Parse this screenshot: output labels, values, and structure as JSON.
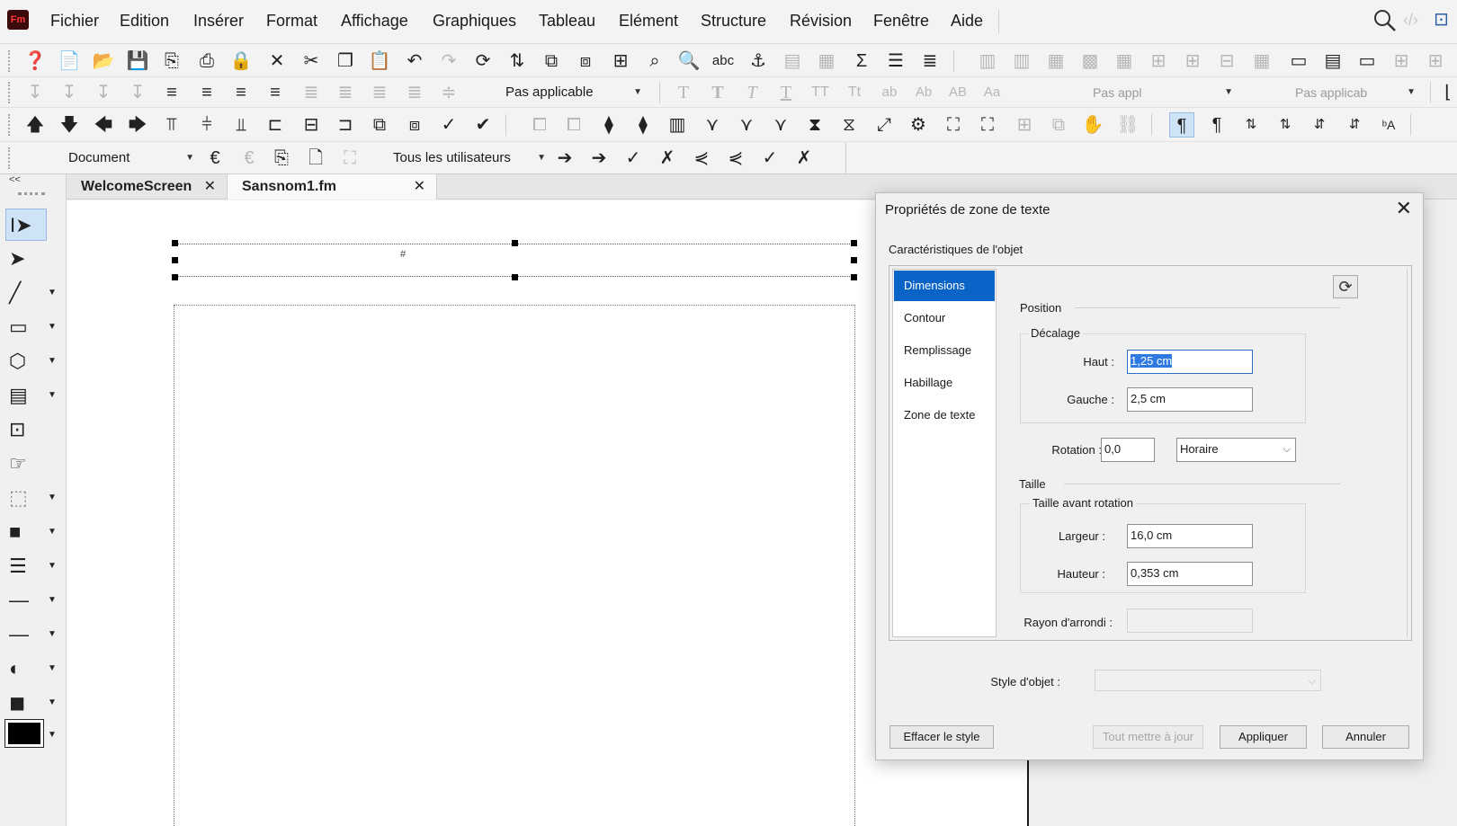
{
  "app": {
    "logo": "Fm"
  },
  "menu": [
    "Fichier",
    "Edition",
    "Insérer",
    "Format",
    "Affichage",
    "Graphiques",
    "Tableau",
    "Elément",
    "Structure",
    "Révision",
    "Fenêtre",
    "Aide"
  ],
  "toolbar": {
    "para_format_select": "Pas applicable",
    "char_format_select": "Pas appl",
    "table_format_select": "Pas applicab",
    "track_view_select": "Document",
    "users_select": "Tous les utilisateurs"
  },
  "tabs": [
    {
      "label": "WelcomeScreen",
      "close": "✕"
    },
    {
      "label": "Sansnom1.fm",
      "close": "✕"
    }
  ],
  "palette": {
    "collapse": "<<"
  },
  "canvas": {
    "header_marker": "#"
  },
  "dialog": {
    "title": "Propriétés de zone de texte",
    "close": "✕",
    "heading": "Caractéristiques de l'objet",
    "categories": [
      "Dimensions",
      "Contour",
      "Remplissage",
      "Habillage",
      "Zone de texte"
    ],
    "selected_category": "Dimensions",
    "position_label": "Position",
    "offset_label": "Décalage",
    "haut_label": "Haut :",
    "haut_value": "1,25 cm",
    "gauche_label": "Gauche :",
    "gauche_value": "2,5 cm",
    "rotation_label": "Rotation :",
    "rotation_value": "0,0",
    "rotation_dir": "Horaire",
    "size_label": "Taille",
    "size_before_rotation": "Taille avant rotation",
    "largeur_label": "Largeur :",
    "largeur_value": "16,0 cm",
    "hauteur_label": "Hauteur :",
    "hauteur_value": "0,353 cm",
    "radius_label": "Rayon d'arrondi :",
    "radius_value": "",
    "object_style_label": "Style d'objet :",
    "object_style_value": "",
    "clear_style_btn": "Effacer le style",
    "update_all_btn": "Tout mettre à jour",
    "apply_btn": "Appliquer",
    "cancel_btn": "Annuler"
  }
}
